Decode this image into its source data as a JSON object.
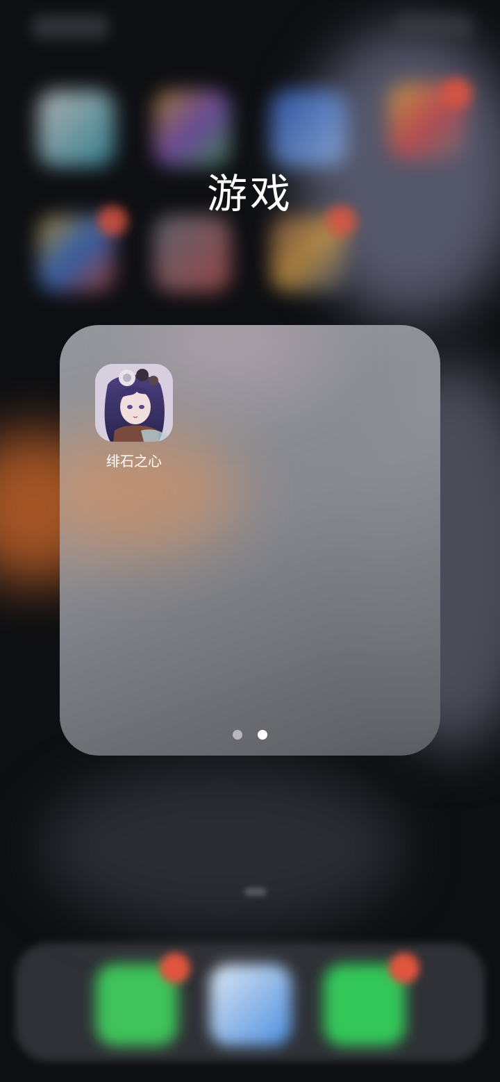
{
  "folder": {
    "title": "游戏",
    "apps": [
      {
        "label": "绯石之心",
        "icon": "anime-character-icon"
      }
    ],
    "pages": {
      "count": 2,
      "current": 2
    }
  },
  "background": {
    "style": "blurred-home-screen",
    "dock_apps": [
      "phone-icon",
      "safari-icon",
      "messages-icon"
    ]
  },
  "colors": {
    "folder_bg": "#9a9ca2",
    "text": "#ffffff",
    "badge": "#e2553f",
    "phone": "#3fc35a",
    "safari": "#4a8fe0",
    "messages": "#34c759"
  }
}
